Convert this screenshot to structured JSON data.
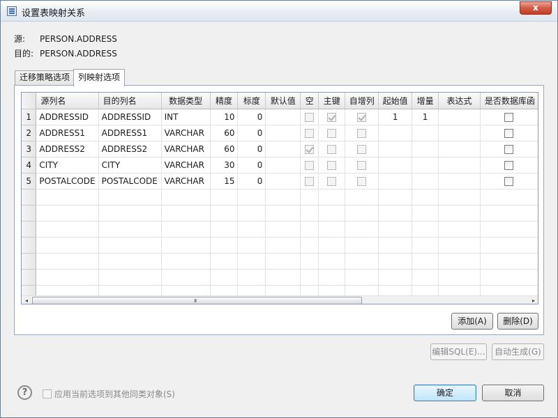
{
  "window": {
    "title": "设置表映射关系",
    "close_glyph": "x"
  },
  "info": {
    "source_label": "源:",
    "source_value": "PERSON.ADDRESS",
    "target_label": "目的:",
    "target_value": "PERSON.ADDRESS"
  },
  "tabs": [
    {
      "label": "迁移策略选项",
      "active": false
    },
    {
      "label": "列映射选项",
      "active": true
    }
  ],
  "grid": {
    "columns": [
      "源列名",
      "目的列名",
      "数据类型",
      "精度",
      "标度",
      "默认值",
      "空",
      "主键",
      "自增列",
      "起始值",
      "增量",
      "表达式",
      "是否数据库函"
    ],
    "rows": [
      {
        "num": "1",
        "src": "ADDRESSID",
        "dst": "ADDRESSID",
        "type": "INT",
        "precision": "10",
        "scale": "0",
        "default": "",
        "nullable": false,
        "pk": true,
        "autoinc": true,
        "start": "1",
        "incr": "1",
        "expr": "",
        "dbfunc": false
      },
      {
        "num": "2",
        "src": "ADDRESS1",
        "dst": "ADDRESS1",
        "type": "VARCHAR",
        "precision": "60",
        "scale": "0",
        "default": "",
        "nullable": false,
        "pk": false,
        "autoinc": false,
        "start": "",
        "incr": "",
        "expr": "",
        "dbfunc": false
      },
      {
        "num": "3",
        "src": "ADDRESS2",
        "dst": "ADDRESS2",
        "type": "VARCHAR",
        "precision": "60",
        "scale": "0",
        "default": "",
        "nullable": true,
        "pk": false,
        "autoinc": false,
        "start": "",
        "incr": "",
        "expr": "",
        "dbfunc": false
      },
      {
        "num": "4",
        "src": "CITY",
        "dst": "CITY",
        "type": "VARCHAR",
        "precision": "30",
        "scale": "0",
        "default": "",
        "nullable": false,
        "pk": false,
        "autoinc": false,
        "start": "",
        "incr": "",
        "expr": "",
        "dbfunc": false
      },
      {
        "num": "5",
        "src": "POSTALCODE",
        "dst": "POSTALCODE",
        "type": "VARCHAR",
        "precision": "15",
        "scale": "0",
        "default": "",
        "nullable": false,
        "pk": false,
        "autoinc": false,
        "start": "",
        "incr": "",
        "expr": "",
        "dbfunc": false
      }
    ],
    "empty_rows": 7
  },
  "scrollbar": {
    "left_arrow": "◂",
    "right_arrow": "▸",
    "grip": "III"
  },
  "buttons": {
    "add": "添加(A)",
    "delete": "删除(D)",
    "edit_sql": "编辑SQL(E)...",
    "auto_generate": "自动生成(G)",
    "ok": "确定",
    "cancel": "取消"
  },
  "footer": {
    "help_glyph": "?",
    "apply_label": "应用当前选项到其他同类对象(S)"
  }
}
